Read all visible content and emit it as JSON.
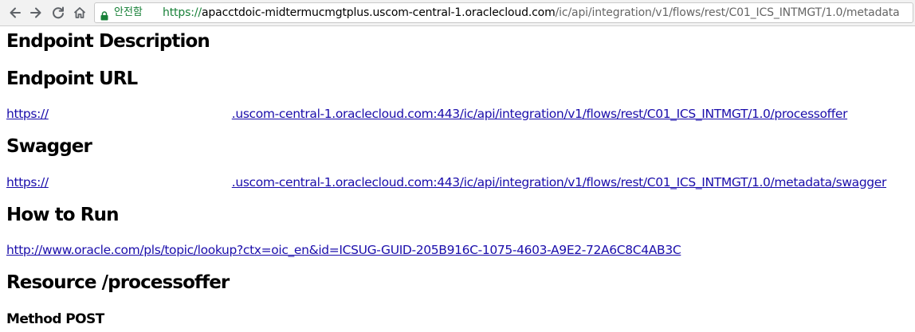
{
  "browser": {
    "secure_label": "안전함",
    "url_scheme": "https://",
    "url_host": "apacctdoic-midtermucmgtplus.uscom-central-1.oraclecloud.com",
    "url_path": "/ic/api/integration/v1/flows/rest/C01_ICS_INTMGT/1.0/metadata",
    "icons": [
      "back-arrow-icon",
      "forward-arrow-icon",
      "reload-icon",
      "home-icon",
      "lock-icon"
    ],
    "colors": {
      "secure": "#188038",
      "link": "#1a0dab"
    }
  },
  "page": {
    "endpoint_description_heading": "Endpoint Description",
    "endpoint_url_heading": "Endpoint URL",
    "endpoint_url": {
      "prefix": "https://",
      "suffix": ".uscom-central-1.oraclecloud.com:443/ic/api/integration/v1/flows/rest/C01_ICS_INTMGT/1.0/processoffer"
    },
    "swagger_heading": "Swagger",
    "swagger_url": {
      "prefix": "https://",
      "suffix": ".uscom-central-1.oraclecloud.com:443/ic/api/integration/v1/flows/rest/C01_ICS_INTMGT/1.0/metadata/swagger"
    },
    "how_to_run_heading": "How to Run",
    "how_to_run_url": "http://www.oracle.com/pls/topic/lookup?ctx=oic_en&id=ICSUG-GUID-205B916C-1075-4603-A9E2-72A6C8C4AB3C",
    "resource_heading": "Resource /processoffer",
    "method_label": "Method POST"
  }
}
